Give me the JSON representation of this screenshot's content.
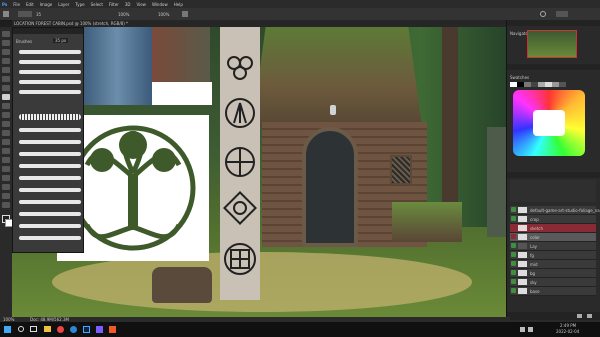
{
  "menu": [
    "File",
    "Edit",
    "Image",
    "Layer",
    "Type",
    "Select",
    "Filter",
    "3D",
    "View",
    "Window",
    "Help"
  ],
  "options_bar": {
    "size": "35",
    "opacity": "100%",
    "flow": "100%"
  },
  "document_tab": "LOCATION FOREST CABIN.psd @ 100% (stretch, RGB/8) *",
  "brushes_panel": {
    "title": "Brushes",
    "size_value": "35 px"
  },
  "navigator_title": "Navigator",
  "swatches_title": "Swatches",
  "layers_title": "Layers",
  "layers": [
    {
      "name": "default-game-art-studio-foliage_name"
    },
    {
      "name": "crop"
    },
    {
      "name": "sketch"
    },
    {
      "name": "color"
    },
    {
      "name": "Lay"
    },
    {
      "name": "fg"
    },
    {
      "name": "mid"
    },
    {
      "name": "bg"
    },
    {
      "name": "sky"
    },
    {
      "name": "base"
    }
  ],
  "status": {
    "zoom": "100%",
    "doc": "Doc: 48.9M/562.3M"
  },
  "taskbar": {
    "time": "2:49 PM",
    "date": "2022-02-04"
  },
  "colors": {
    "accent": "#3f8f3f",
    "canvas_green": "#52702f",
    "stone": "#c9c1b6"
  },
  "celtic_symbols": [
    "triskele-icon",
    "awen-icon",
    "celtic-cross-icon",
    "knot-icon",
    "shield-knot-icon"
  ]
}
